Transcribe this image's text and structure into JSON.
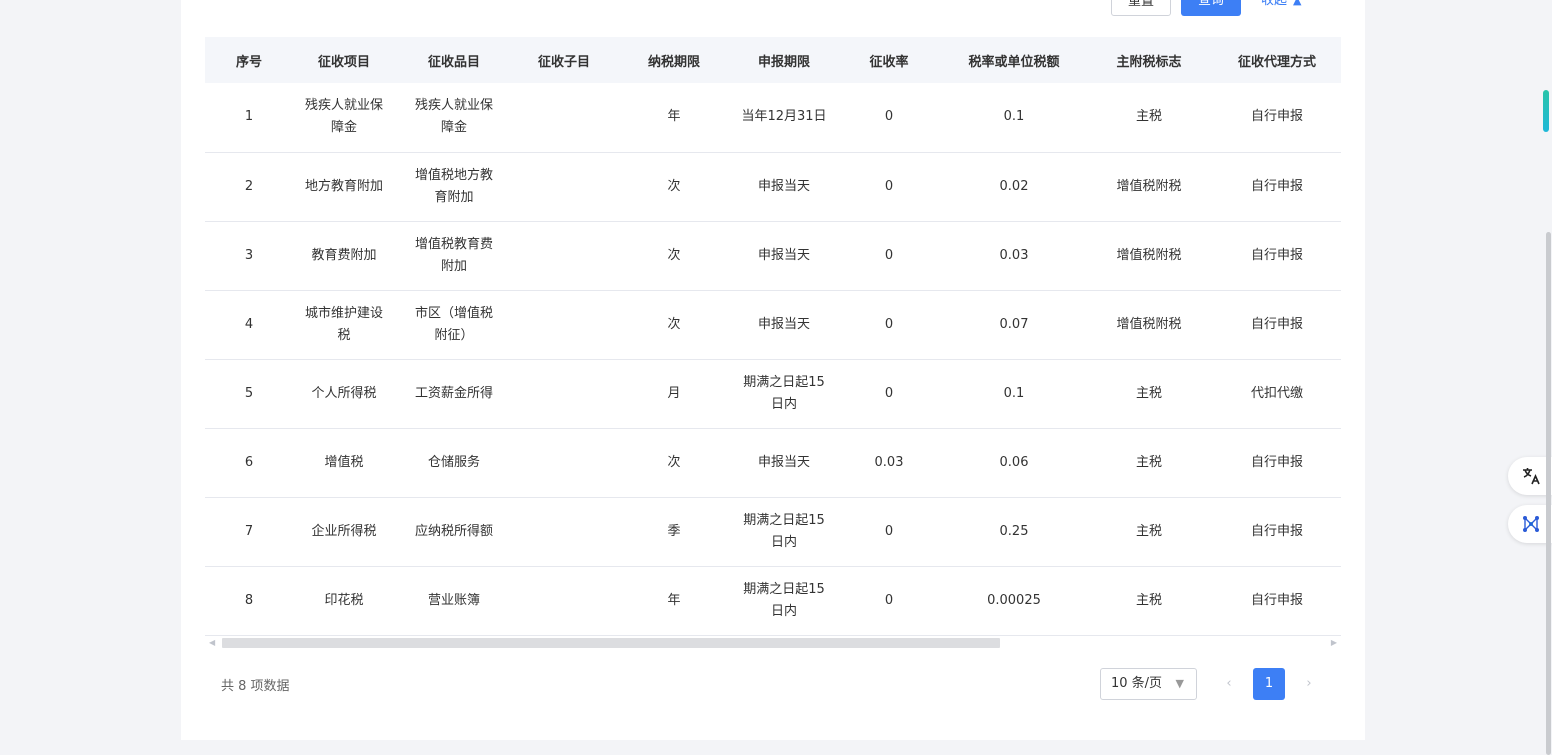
{
  "actions": {
    "reset_label": "重置",
    "query_label": "查询",
    "collapse_label": "收起"
  },
  "table": {
    "columns": [
      "序号",
      "征收项目",
      "征收品目",
      "征收子目",
      "纳税期限",
      "申报期限",
      "征收率",
      "税率或单位税额",
      "主附税标志",
      "征收代理方式"
    ],
    "rows": [
      [
        "1",
        "残疾人就业保障金",
        "残疾人就业保障金",
        "",
        "年",
        "当年12月31日",
        "0",
        "0.1",
        "主税",
        "自行申报"
      ],
      [
        "2",
        "地方教育附加",
        "增值税地方教育附加",
        "",
        "次",
        "申报当天",
        "0",
        "0.02",
        "增值税附税",
        "自行申报"
      ],
      [
        "3",
        "教育费附加",
        "增值税教育费附加",
        "",
        "次",
        "申报当天",
        "0",
        "0.03",
        "增值税附税",
        "自行申报"
      ],
      [
        "4",
        "城市维护建设税",
        "市区（增值税附征）",
        "",
        "次",
        "申报当天",
        "0",
        "0.07",
        "增值税附税",
        "自行申报"
      ],
      [
        "5",
        "个人所得税",
        "工资薪金所得",
        "",
        "月",
        "期满之日起15日内",
        "0",
        "0.1",
        "主税",
        "代扣代缴"
      ],
      [
        "6",
        "增值税",
        "仓储服务",
        "",
        "次",
        "申报当天",
        "0.03",
        "0.06",
        "主税",
        "自行申报"
      ],
      [
        "7",
        "企业所得税",
        "应纳税所得额",
        "",
        "季",
        "期满之日起15日内",
        "0",
        "0.25",
        "主税",
        "自行申报"
      ],
      [
        "8",
        "印花税",
        "营业账簿",
        "",
        "年",
        "期满之日起15日内",
        "0",
        "0.00025",
        "主税",
        "自行申报"
      ]
    ]
  },
  "pagination": {
    "total_text": "共 8 项数据",
    "page_size_label": "10 条/页",
    "current_page": "1"
  },
  "colors": {
    "primary": "#3d7ff5",
    "header_bg": "#f4f6fa",
    "page_bg": "#f3f4f7"
  },
  "icons": [
    "chevron-up-icon",
    "chevron-down-icon",
    "chevron-left-icon",
    "chevron-right-icon",
    "translate-icon",
    "network-icon"
  ]
}
